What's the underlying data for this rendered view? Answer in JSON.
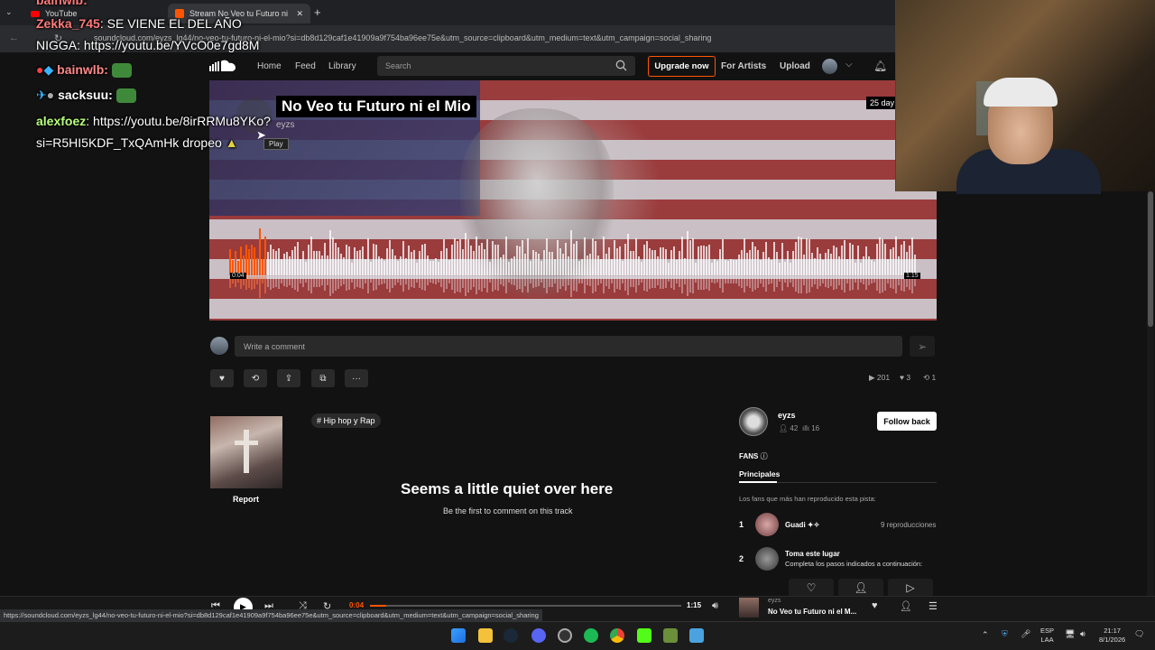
{
  "browser": {
    "tabs": [
      {
        "label": "YouTube"
      },
      {
        "label": "Stream No Veo tu Futuro ni"
      }
    ],
    "new_tab": "+",
    "url": "soundcloud.com/eyzs_lg44/no-veo-tu-futuro-ni-el-mio?si=db8d129caf1e41909a9f754ba96ee75e&utm_source=clipboard&utm_medium=text&utm_campaign=social_sharing",
    "status_url": "https://soundcloud.com/eyzs_lg44/no-veo-tu-futuro-ni-el-mio?si=db8d129caf1e41909a9f754ba96ee75e&utm_source=clipboard&utm_medium=text&utm_campaign=social_sharing"
  },
  "header": {
    "nav": [
      "Home",
      "Feed",
      "Library"
    ],
    "search_placeholder": "Search",
    "upgrade": "Upgrade now",
    "for_artists": "For Artists",
    "upload": "Upload"
  },
  "track": {
    "title": "No Veo tu Futuro ni el Mio",
    "artist": "eyzs",
    "age": "25 day",
    "play_tooltip": "Play",
    "time_current": "0:04",
    "time_total": "1:15",
    "progress": 0.053
  },
  "comment": {
    "placeholder": "Write a comment"
  },
  "actions": {
    "like": "♥",
    "repost": "⟲",
    "share": "⇪",
    "copy": "⧉",
    "more": "···"
  },
  "stats": {
    "plays": "201",
    "likes": "3",
    "reposts": "1"
  },
  "sidebar_left": {
    "report": "Report"
  },
  "genre": "# Hip hop y Rap",
  "empty_comments": {
    "title": "Seems a little quiet over here",
    "subtitle": "Be the first to comment on this track"
  },
  "artist_card": {
    "name": "eyzs",
    "followers": "42",
    "tracks": "16",
    "follow_button": "Follow back"
  },
  "fans": {
    "label": "FANS",
    "tab": "Principales",
    "description": "Los fans que más han reproducido esta pista:",
    "items": [
      {
        "rank": "1",
        "name": "Guadi ✦✧",
        "plays": "9 reproducciones"
      },
      {
        "rank": "2",
        "name": "Toma este lugar",
        "extra": "Completa los pasos indicados a continuación:"
      }
    ]
  },
  "player": {
    "time_current": "0:04",
    "time_total": "1:15",
    "now_playing_artist": "eyzs",
    "now_playing_title": "No Veo tu Futuro ni el M..."
  },
  "taskbar": {
    "lang": "ESP",
    "lang2": "LAA",
    "time": "21:17",
    "date": "8/1/2026"
  },
  "chat": [
    {
      "user": "bainwlb:",
      "text": "",
      "color": "#ff7a7a"
    },
    {
      "user": "Zekka_745",
      "text": ": SE VIENE EL            DEL AÑO",
      "color": "#ff7a7a"
    },
    {
      "user": "",
      "text": "NIGGA: https://youtu.be/YVcO0e7gd8M",
      "color": "#ffffff"
    },
    {
      "user": "bainwlb:",
      "text": "",
      "color": "#ff7a7a"
    },
    {
      "user": "sacksuu:",
      "text": "",
      "color": "#ffffff"
    },
    {
      "user": "alexfoez",
      "text": ": https://youtu.be/8irRRMu8YKo?",
      "color": "#b8ff7a"
    },
    {
      "user": "",
      "text": "si=R5HI5KDF_TxQAmHk dropeo",
      "color": "#ffffff"
    }
  ]
}
